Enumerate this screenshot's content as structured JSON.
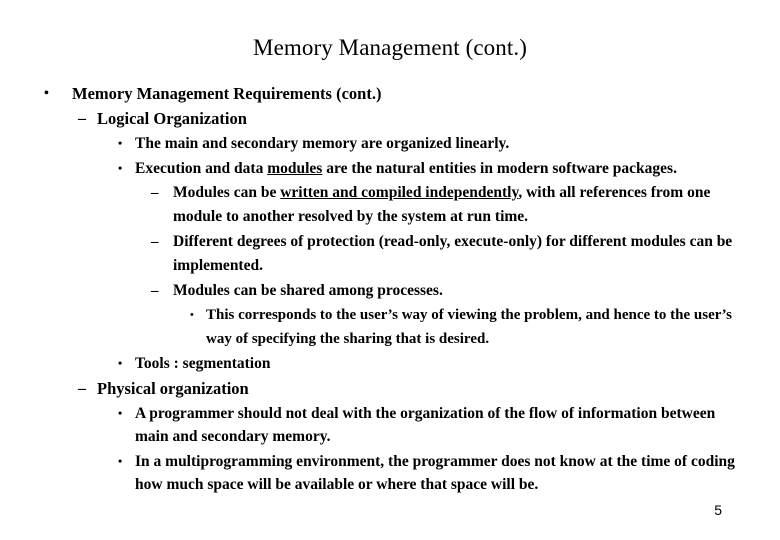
{
  "slide": {
    "title": "Memory Management (cont.)",
    "page_number": "5",
    "bullet_glyphs": {
      "round": "•",
      "dash": "–"
    },
    "items": [
      {
        "level": 1,
        "text": "Memory Management Requirements (cont.)"
      },
      {
        "level": 2,
        "text": "Logical Organization"
      },
      {
        "level": 3,
        "text": "The main and secondary memory are organized linearly."
      },
      {
        "level": 3,
        "text_before": "Execution and data ",
        "text_underlined": "modules",
        "text_after": " are the natural entities in modern software packages."
      },
      {
        "level": 4,
        "text_before": "Modules can be ",
        "text_underlined": "written and compiled independently",
        "text_after": ", with all references from one module to another resolved by the system at run time."
      },
      {
        "level": 4,
        "text": "Different degrees of protection (read-only, execute-only) for different modules can be implemented."
      },
      {
        "level": 4,
        "text": "Modules can be shared among processes."
      },
      {
        "level": 5,
        "text": "This corresponds to the user’s way of viewing the problem, and hence to the user’s way of specifying the sharing that is desired."
      },
      {
        "level": 3,
        "text": "Tools : segmentation"
      },
      {
        "level": 2,
        "text": "Physical organization"
      },
      {
        "level": 3,
        "text": "A programmer should not deal with the organization of the flow of information between main and secondary memory."
      },
      {
        "level": 3,
        "text": "In a multiprogramming environment, the programmer does not know at the time of coding how much space will be available or where that space will be."
      }
    ]
  }
}
